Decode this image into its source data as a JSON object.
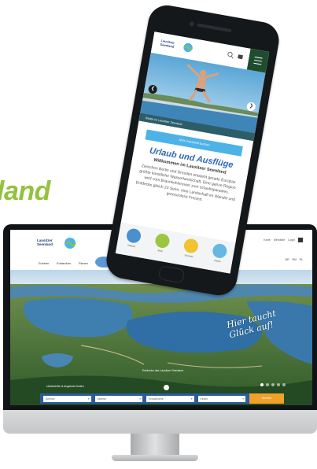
{
  "tagline": "land",
  "colors": {
    "tagline_green": "#93c23f",
    "brand_blue": "#2f68b7",
    "cta_blue": "#4db3e6",
    "menu_green": "#1e4d2e",
    "search_orange": "#f0a12a",
    "search_bar_blue": "#2b5c9e"
  },
  "desktop": {
    "logo_text": "Lausitzer\nSeenland",
    "nav": [
      "Erleben",
      "Entdecken",
      "Planen"
    ],
    "topbar": [
      "Karte",
      "Merkliste",
      "Login"
    ],
    "languages": [
      "DE",
      "EN",
      "PL"
    ],
    "quicklinks": [
      {
        "icon": "boat-icon",
        "color": "#4b8fd0"
      },
      {
        "icon": "bike-icon",
        "color": "#9cc641"
      },
      {
        "icon": "sun-icon",
        "color": "#f1c232"
      },
      {
        "icon": "snowflake-icon",
        "color": "#66b7e3"
      }
    ],
    "hero_slogan": "Hier taucht\nGlück auf!",
    "hero_caption": "Entdecke das Lausitzer Seenland",
    "search_hint": "Unterkünfte & Angebote finden",
    "search_fields": [
      "Anreise",
      "Abreise",
      "Erwachsene",
      "Kinder"
    ],
    "search_button": "Suchen",
    "slides_total": 5,
    "slide_active": 1
  },
  "mobile": {
    "logo_text": "Lausitzer\nSeenland",
    "hero_caption": "Baden im Lausitzer Seenland",
    "cta": "Jetzt Unterkunft buchen",
    "title": "Urlaub und Ausflüge",
    "subtitle": "Willkommen im Lausitzer Seenland",
    "body": "Zwischen Berlin und Dresden entsteht gerade Europas größte künstliche Wasserlandschaft. Eine ganze Region wird vom Braunkohlerevier zum Urlaubsparadies. Entdecke gleich 23 Seen, eine Landschaft im Wandel und grenzenlose Freizeit.",
    "icons": [
      {
        "label": "Wasser",
        "color": "#4b8fd0"
      },
      {
        "label": "Aktiv",
        "color": "#9cc641"
      },
      {
        "label": "Sommer",
        "color": "#f1c232"
      },
      {
        "label": "Winter",
        "color": "#66b7e3"
      }
    ]
  }
}
